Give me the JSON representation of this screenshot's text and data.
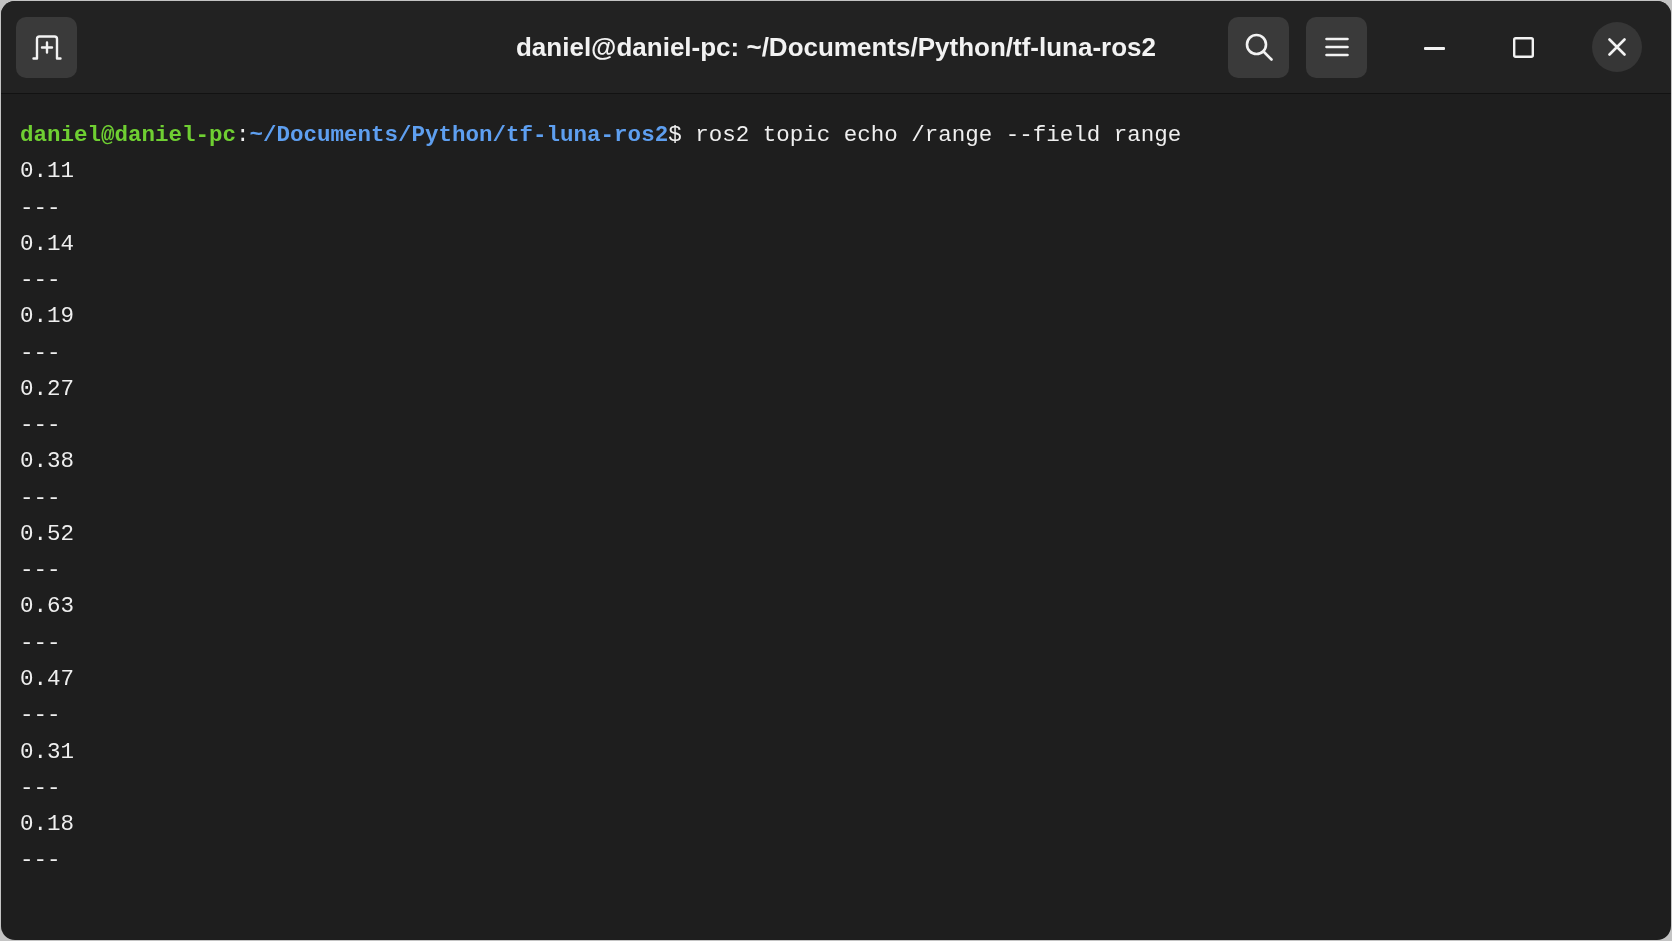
{
  "window": {
    "title": "daniel@daniel-pc: ~/Documents/Python/tf-luna-ros2"
  },
  "terminal": {
    "prompt": {
      "user_host": "daniel@daniel-pc",
      "separator": ":",
      "path": "~/Documents/Python/tf-luna-ros2",
      "symbol": "$"
    },
    "command": "ros2 topic echo /range --field range",
    "output": [
      "0.11",
      "---",
      "0.14",
      "---",
      "0.19",
      "---",
      "0.27",
      "---",
      "0.38",
      "---",
      "0.52",
      "---",
      "0.63",
      "---",
      "0.47",
      "---",
      "0.31",
      "---",
      "0.18",
      "---"
    ]
  }
}
